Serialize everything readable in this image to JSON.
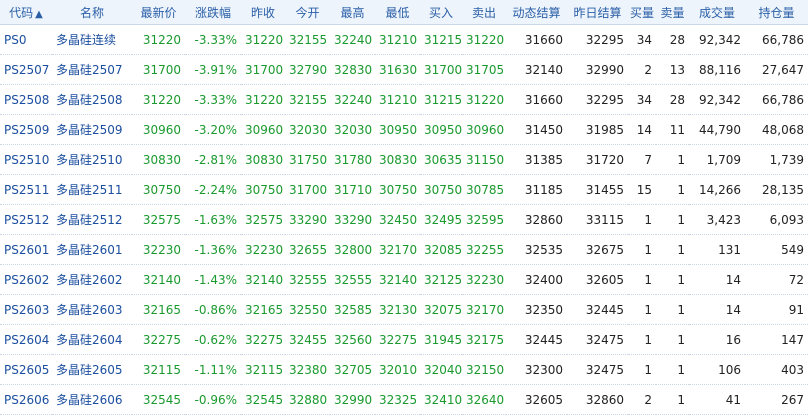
{
  "headers": [
    "代码",
    "名称",
    "最新价",
    "涨跌幅",
    "昨收",
    "今开",
    "最高",
    "最低",
    "买入",
    "卖出",
    "动态结算",
    "昨日结算",
    "买量",
    "卖量",
    "成交量",
    "持仓量"
  ],
  "sort_indicator": "▲",
  "rows": [
    [
      "PS0",
      "多晶硅连续",
      "31220",
      "-3.33%",
      "31220",
      "32155",
      "32240",
      "31210",
      "31215",
      "31220",
      "31660",
      "32295",
      "34",
      "28",
      "92,342",
      "66,786"
    ],
    [
      "PS2507",
      "多晶硅2507",
      "31700",
      "-3.91%",
      "31700",
      "32790",
      "32830",
      "31630",
      "31700",
      "31705",
      "32140",
      "32990",
      "2",
      "13",
      "88,116",
      "27,647"
    ],
    [
      "PS2508",
      "多晶硅2508",
      "31220",
      "-3.33%",
      "31220",
      "32155",
      "32240",
      "31210",
      "31215",
      "31220",
      "31660",
      "32295",
      "34",
      "28",
      "92,342",
      "66,786"
    ],
    [
      "PS2509",
      "多晶硅2509",
      "30960",
      "-3.20%",
      "30960",
      "32030",
      "32030",
      "30950",
      "30950",
      "30960",
      "31450",
      "31985",
      "14",
      "11",
      "44,790",
      "48,068"
    ],
    [
      "PS2510",
      "多晶硅2510",
      "30830",
      "-2.81%",
      "30830",
      "31750",
      "31780",
      "30830",
      "30635",
      "31150",
      "31385",
      "31720",
      "7",
      "1",
      "1,709",
      "1,739"
    ],
    [
      "PS2511",
      "多晶硅2511",
      "30750",
      "-2.24%",
      "30750",
      "31700",
      "31710",
      "30750",
      "30750",
      "30785",
      "31185",
      "31455",
      "15",
      "1",
      "14,266",
      "28,135"
    ],
    [
      "PS2512",
      "多晶硅2512",
      "32575",
      "-1.63%",
      "32575",
      "33290",
      "33290",
      "32450",
      "32495",
      "32595",
      "32860",
      "33115",
      "1",
      "1",
      "3,423",
      "6,093"
    ],
    [
      "PS2601",
      "多晶硅2601",
      "32230",
      "-1.36%",
      "32230",
      "32655",
      "32800",
      "32170",
      "32085",
      "32255",
      "32535",
      "32675",
      "1",
      "1",
      "131",
      "549"
    ],
    [
      "PS2602",
      "多晶硅2602",
      "32140",
      "-1.43%",
      "32140",
      "32555",
      "32555",
      "32140",
      "32125",
      "32230",
      "32400",
      "32605",
      "1",
      "1",
      "14",
      "72"
    ],
    [
      "PS2603",
      "多晶硅2603",
      "32165",
      "-0.86%",
      "32165",
      "32550",
      "32585",
      "32130",
      "32075",
      "32170",
      "32350",
      "32445",
      "1",
      "1",
      "14",
      "91"
    ],
    [
      "PS2604",
      "多晶硅2604",
      "32275",
      "-0.62%",
      "32275",
      "32455",
      "32560",
      "32275",
      "31945",
      "32175",
      "32445",
      "32475",
      "1",
      "1",
      "16",
      "147"
    ],
    [
      "PS2605",
      "多晶硅2605",
      "32115",
      "-1.11%",
      "32115",
      "32380",
      "32705",
      "32010",
      "32040",
      "32150",
      "32300",
      "32475",
      "1",
      "1",
      "106",
      "403"
    ],
    [
      "PS2606",
      "多晶硅2606",
      "32545",
      "-0.96%",
      "32545",
      "32880",
      "32990",
      "32325",
      "32410",
      "32640",
      "32605",
      "32860",
      "2",
      "1",
      "41",
      "267"
    ]
  ],
  "colors": {
    "price_down": "#1a9a2e",
    "link": "#1b4e9e",
    "header_text": "#2a5fa8"
  }
}
